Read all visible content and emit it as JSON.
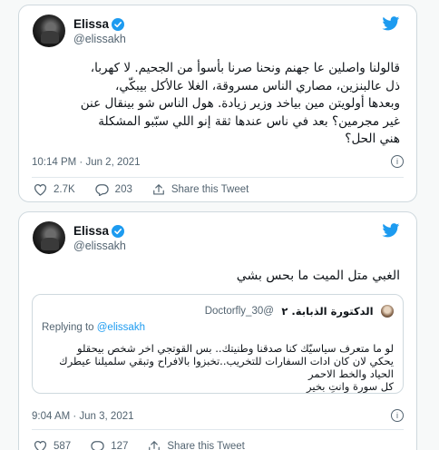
{
  "tweets": [
    {
      "author": {
        "name": "Elissa",
        "handle": "@elissakh",
        "verified": true
      },
      "text_lines": [
        "قالولنا واصلين عا جهنم ونحنا صرنا بأسوأ من الجحيم. لا كهربا،",
        "ذل عالبنزين، مصاري الناس مسروقة، الغلا عالأكل بيبكّي،",
        "وبعدها أولويتن مين بياخد وزير زيادة. هول الناس شو بينقال عنن",
        "غير مجرمين؟ بعد في ناس عندها ثقة إنو اللي سبّبو المشكلة",
        "هني الحل؟"
      ],
      "timestamp": "10:14 PM · Jun 2, 2021",
      "stats": {
        "likes": "2.7K",
        "replies": "203",
        "share_label": "Share this Tweet"
      }
    },
    {
      "author": {
        "name": "Elissa",
        "handle": "@elissakh",
        "verified": true
      },
      "text_lines": [
        "الغبي متل الميت ما بحس بشي"
      ],
      "quote": {
        "name": "الدكتورة الذبابة. ٢",
        "handle": "@Doctorfly_30",
        "reply_prefix": "Replying to",
        "reply_handle": "@elissakh",
        "text_lines": [
          "لو ما متعرف سياسيّك كنا صدقنا وطنيتك.. بس القوتجي اخر شخص بيحقلو",
          "يحكي لان كان ادات السفارات للتخريب..تخبزوا بالافراح وتبقي سلميلنا عيطرك",
          "الحياد والخط الاحمر",
          "كل سورة وانتِ بخير"
        ]
      },
      "timestamp": "9:04 AM · Jun 3, 2021",
      "stats": {
        "likes": "587",
        "replies": "127",
        "share_label": "Share this Tweet"
      }
    }
  ],
  "icons": {
    "brand": "twitter-bird-icon",
    "verified": "verified-badge-icon",
    "info": "info-icon",
    "like": "heart-icon",
    "reply": "reply-bubble-icon",
    "share": "share-upload-icon"
  },
  "colors": {
    "accent": "#1d9bf0",
    "text": "#0f1419",
    "muted": "#536471",
    "border": "#cfd9de"
  }
}
